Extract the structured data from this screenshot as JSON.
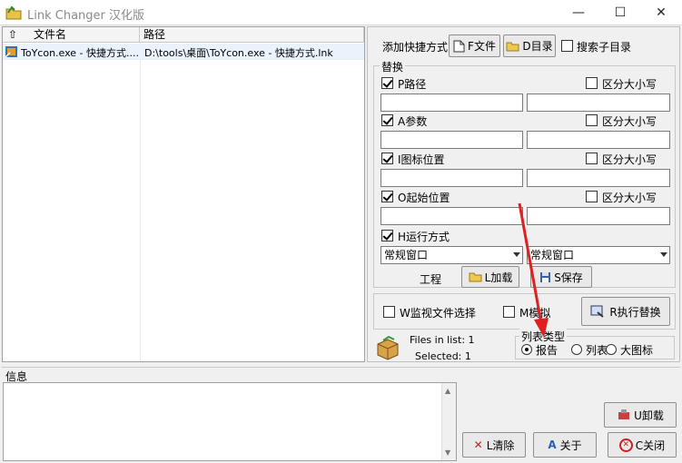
{
  "window": {
    "title": "Link Changer 汉化版",
    "controls": [
      "—",
      "☐",
      "✕"
    ]
  },
  "list": {
    "col_filename": "文件名",
    "col_path": "路径",
    "rows": [
      {
        "name": "ToYcon.exe - 快捷方式....",
        "path": "D:\\tools\\桌面\\ToYcon.exe - 快捷方式.lnk"
      }
    ]
  },
  "add_shortcut": {
    "label": "添加快捷方式",
    "file_button": "F文件",
    "dir_button": "D目录",
    "search_subdirs": "搜索子目录"
  },
  "replace": {
    "group_title": "替换",
    "case_label": "区分大小写",
    "rows": [
      {
        "label": "P路径",
        "checked": true,
        "case": false
      },
      {
        "label": "A参数",
        "checked": true,
        "case": false
      },
      {
        "label": "I图标位置",
        "checked": true,
        "case": false
      },
      {
        "label": "O起始位置",
        "checked": true,
        "case": false
      }
    ],
    "run_mode_label": "H运行方式",
    "run_mode_left": "常规窗口",
    "run_mode_right": "常规窗口"
  },
  "project": {
    "label": "工程",
    "load_button": "L加载",
    "save_button": "S保存"
  },
  "options": {
    "monitor_label": "W监视文件选择",
    "simulate_label": "M模拟",
    "execute_button": "R执行替换"
  },
  "status": {
    "files_in_list": "Files in list: 1",
    "selected": "Selected: 1"
  },
  "list_type": {
    "title": "列表类型",
    "options": [
      "报告",
      "列表",
      "大图标"
    ],
    "selected": 0
  },
  "info": {
    "label": "信息",
    "unload_button": "U卸载",
    "clear_button": "L清除",
    "about_button": "关于",
    "close_button": "C关闭"
  },
  "colors": {
    "selection": "#eaf2fb",
    "arrow": "#e02020"
  }
}
